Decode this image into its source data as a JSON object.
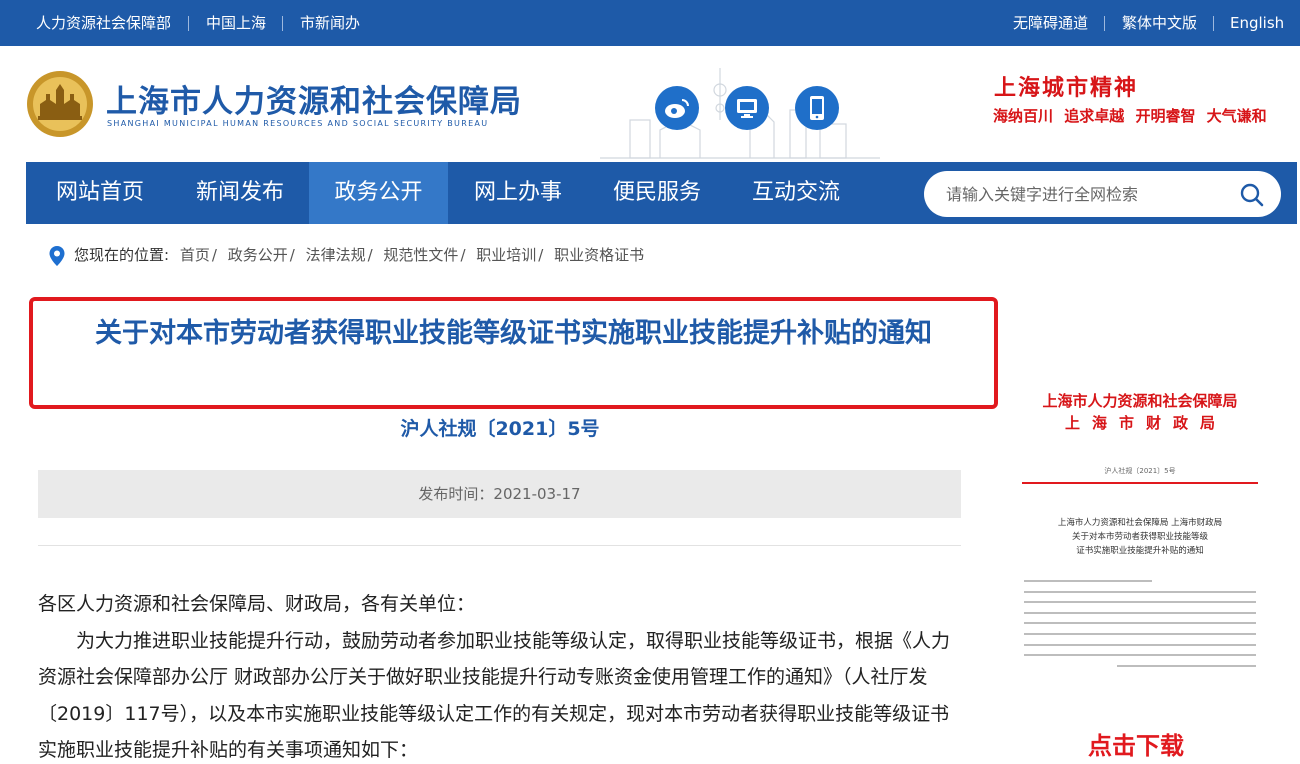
{
  "topbar": {
    "left_links": [
      "人力资源社会保障部",
      "中国上海",
      "市新闻办"
    ],
    "right_links": [
      "无障碍通道",
      "繁体中文版",
      "English"
    ]
  },
  "header": {
    "site_title": "上海市人力资源和社会保障局",
    "site_title_en": "SHANGHAI MUNICIPAL HUMAN RESOURCES AND SOCIAL SECURITY BUREAU",
    "social_icons": [
      "weibo-icon",
      "computer-icon",
      "mobile-icon"
    ],
    "spirit_title": "上海城市精神",
    "spirit_words": "海纳百川 追求卓越 开明睿智 大气谦和"
  },
  "nav": {
    "items": [
      "网站首页",
      "新闻发布",
      "政务公开",
      "网上办事",
      "便民服务",
      "互动交流"
    ],
    "active": "政务公开",
    "search_placeholder": "请输入关键字进行全网检索"
  },
  "breadcrumb": {
    "label": "您现在的位置:",
    "items": [
      "首页",
      "政务公开",
      "法律法规",
      "规范性文件",
      "职业培训",
      "职业资格证书"
    ]
  },
  "article": {
    "title": "关于对本市劳动者获得职业技能等级证书实施职业技能提升补贴的通知",
    "doc_number": "沪人社规〔2021〕5号",
    "publish_time": "发布时间：2021-03-17",
    "salutation": "各区人力资源和社会保障局、财政局，各有关单位：",
    "paragraph": "为大力推进职业技能提升行动，鼓励劳动者参加职业技能等级认定，取得职业技能等级证书，根据《人力资源社会保障部办公厅 财政部办公厅关于做好职业技能提升行动专账资金使用管理工作的通知》（人社厅发〔2019〕117号），以及本市实施职业技能等级认定工作的有关规定，现对本市劳动者获得职业技能等级证书实施职业技能提升补贴的有关事项通知如下："
  },
  "sidebar": {
    "doc_head_line1": "上海市人力资源和社会保障局",
    "doc_head_line2": "上海市财政局",
    "doc_number": "沪人社规〔2021〕5号",
    "doc_subject_lines": [
      "上海市人力资源和社会保障局 上海市财政局",
      "关于对本市劳动者获得职业技能等级",
      "证书实施职业技能提升补贴的通知"
    ],
    "download_label": "点击下载"
  },
  "colors": {
    "primary_blue": "#1e5aa8",
    "nav_active": "#3478c8",
    "highlight_red": "#e1191e",
    "title_blue": "#1f5aa8"
  }
}
